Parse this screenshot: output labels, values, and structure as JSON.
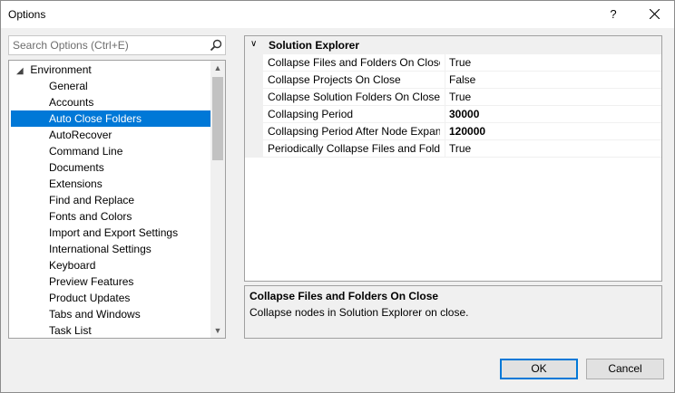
{
  "window": {
    "title": "Options",
    "help_label": "?"
  },
  "search": {
    "placeholder": "Search Options (Ctrl+E)"
  },
  "tree": {
    "root_label": "Environment",
    "items": [
      {
        "label": "General"
      },
      {
        "label": "Accounts"
      },
      {
        "label": "Auto Close Folders",
        "selected": true
      },
      {
        "label": "AutoRecover"
      },
      {
        "label": "Command Line"
      },
      {
        "label": "Documents"
      },
      {
        "label": "Extensions"
      },
      {
        "label": "Find and Replace"
      },
      {
        "label": "Fonts and Colors"
      },
      {
        "label": "Import and Export Settings"
      },
      {
        "label": "International Settings"
      },
      {
        "label": "Keyboard"
      },
      {
        "label": "Preview Features"
      },
      {
        "label": "Product Updates"
      },
      {
        "label": "Tabs and Windows"
      },
      {
        "label": "Task List"
      }
    ]
  },
  "grid": {
    "category": "Solution Explorer",
    "properties": [
      {
        "name": "Collapse Files and Folders On Close",
        "value": "True",
        "bold": false
      },
      {
        "name": "Collapse Projects On Close",
        "value": "False",
        "bold": false
      },
      {
        "name": "Collapse Solution Folders On Close",
        "value": "True",
        "bold": false
      },
      {
        "name": "Collapsing Period",
        "value": "30000",
        "bold": true
      },
      {
        "name": "Collapsing Period After Node Expans",
        "value": "120000",
        "bold": true
      },
      {
        "name": "Periodically Collapse Files and Folder",
        "value": "True",
        "bold": false
      }
    ]
  },
  "description": {
    "title": "Collapse Files and Folders On Close",
    "text": "Collapse nodes in Solution Explorer on close."
  },
  "buttons": {
    "ok": "OK",
    "cancel": "Cancel"
  },
  "colors": {
    "selection": "#0078d7",
    "focus_border": "#0078d7"
  }
}
